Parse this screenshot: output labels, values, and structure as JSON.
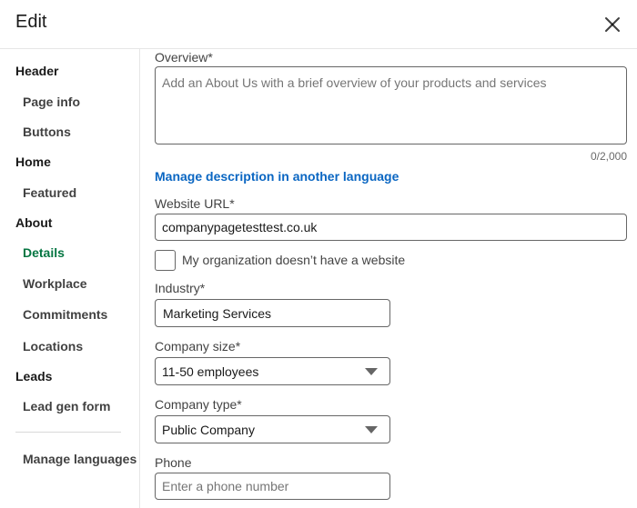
{
  "modal": {
    "title": "Edit",
    "close_icon": "close-icon"
  },
  "sidebar": {
    "items": [
      {
        "label": "Header",
        "kind": "section"
      },
      {
        "label": "Page info",
        "kind": "sub"
      },
      {
        "label": "Buttons",
        "kind": "sub"
      },
      {
        "label": "Home",
        "kind": "section"
      },
      {
        "label": "Featured",
        "kind": "sub"
      },
      {
        "label": "About",
        "kind": "section"
      },
      {
        "label": "Details",
        "kind": "sub",
        "active": true
      },
      {
        "label": "Workplace",
        "kind": "sub"
      },
      {
        "label": "Commitments",
        "kind": "sub"
      },
      {
        "label": "Locations",
        "kind": "sub"
      },
      {
        "label": "Leads",
        "kind": "section"
      },
      {
        "label": "Lead gen form",
        "kind": "sub"
      }
    ],
    "manage_languages": "Manage languages"
  },
  "form": {
    "overview": {
      "label": "Overview*",
      "value": "",
      "placeholder": "Add an About Us with a brief overview of your products and services",
      "counter": "0/2,000"
    },
    "manage_description_link": "Manage description in another language",
    "website": {
      "label": "Website URL*",
      "value": "companypagetesttest.co.uk"
    },
    "no_website_checkbox": {
      "label": "My organization doesn’t have a website",
      "checked": false
    },
    "industry": {
      "label": "Industry*",
      "value": "Marketing Services"
    },
    "company_size": {
      "label": "Company size*",
      "value": "11-50 employees"
    },
    "company_type": {
      "label": "Company type*",
      "value": "Public Company"
    },
    "phone": {
      "label": "Phone",
      "value": "",
      "placeholder": "Enter a phone number"
    }
  },
  "colors": {
    "accent_link": "#0a66c2",
    "active_nav": "#057642"
  }
}
